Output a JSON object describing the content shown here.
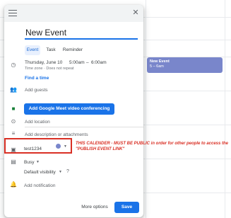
{
  "event_title": "New Event",
  "tabs": [
    "Event",
    "Task",
    "Reminder"
  ],
  "datetime": {
    "date": "Thursday, June 10",
    "start": "5:00am",
    "dash": "–",
    "end": "6:00am",
    "timezone_note": "Time zone · Does not repeat"
  },
  "find_time": "Find a time",
  "add_guests": "Add guests",
  "meet_button": "Add Google Meet video conferencing",
  "add_location": "Add location",
  "add_description": "Add description or attachments",
  "calendar_name": "test1234",
  "calendar_color": "#7986cb",
  "busy_status": "Busy",
  "visibility": "Default visibility",
  "add_notification": "Add notification",
  "annotation_note": "THIS CALENDER - MUST BE PUBLIC in order for other people to access the \"PUBLISH EVENT LINK\"",
  "more_options": "More options",
  "save": "Save",
  "chip": {
    "title": "New Event",
    "time": "5 – 6am"
  }
}
